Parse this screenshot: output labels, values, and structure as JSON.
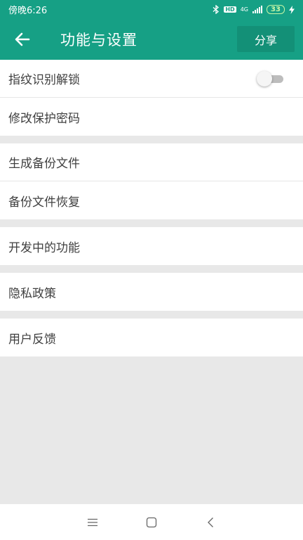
{
  "status_bar": {
    "time": "傍晚6:26",
    "hd_badge": "HD",
    "network": "4G",
    "battery": "33"
  },
  "app_bar": {
    "title": "功能与设置",
    "share_label": "分享",
    "back_icon": "arrow-left-icon",
    "background_color": "#16a085"
  },
  "settings": {
    "fingerprint_unlock": {
      "label": "指纹识别解锁",
      "enabled": false
    },
    "change_password": "修改保护密码",
    "create_backup": "生成备份文件",
    "restore_backup": "备份文件恢复",
    "features_in_development": "开发中的功能",
    "privacy_policy": "隐私政策",
    "user_feedback": "用户反馈"
  },
  "nav_bar": {
    "icons": [
      "menu-icon",
      "home-icon",
      "back-icon"
    ]
  }
}
